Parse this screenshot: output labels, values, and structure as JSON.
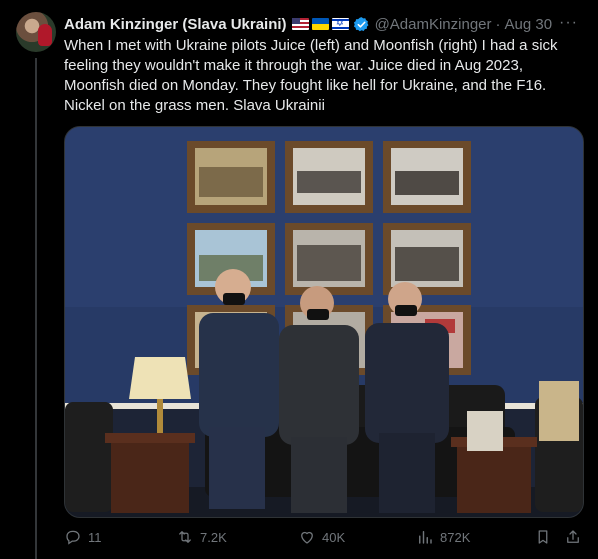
{
  "tweet": {
    "author_name": "Adam Kinzinger (Slava Ukraini)",
    "handle": "@AdamKinzinger",
    "separator": "·",
    "date": "Aug 30",
    "more_label": "···",
    "text_lines": [
      "When I met with Ukraine pilots Juice (left) and Moonfish (right) I had a sick",
      "feeling they wouldn't make it through the war.  Juice died in Aug 2023,",
      "Moonfish died on Monday.  They fought like hell for Ukraine, and the F16.",
      "Nickel on the grass men.  Slava Ukrainii"
    ],
    "flags": [
      "us-flag-icon",
      "ukraine-flag-icon",
      "israel-flag-icon"
    ],
    "verified_icon": "verified-badge-icon"
  },
  "actions": {
    "replies": "11",
    "reposts": "7.2K",
    "likes": "40K",
    "views": "872K"
  },
  "colors": {
    "background": "#000000",
    "text": "#e7e9ea",
    "muted": "#71767b",
    "verified": "#1d9bf0",
    "wall": "#2b3f6e"
  }
}
